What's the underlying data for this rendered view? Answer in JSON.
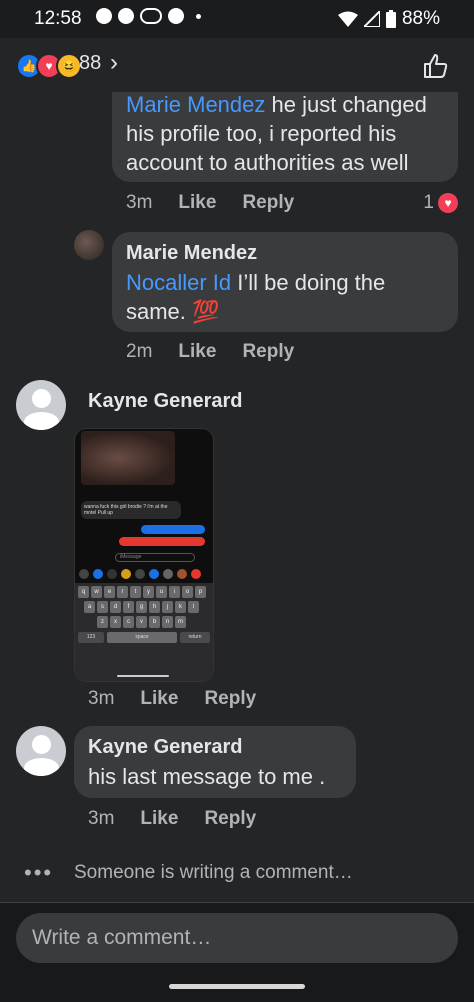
{
  "status": {
    "time": "12:58",
    "battery": "88%"
  },
  "reactions": {
    "count": "88",
    "chevron": "›"
  },
  "comments": [
    {
      "mention": "Marie Mendez",
      "text_after_mention": " he just changed his profile too, i reported his account to authorities as well",
      "time": "3m",
      "like": "Like",
      "reply": "Reply",
      "reaction_count": "1"
    },
    {
      "author": "Marie Mendez",
      "mention": "Nocaller Id",
      "text_after_mention": " I’ll be doing the same. 💯",
      "time": "2m",
      "like": "Like",
      "reply": "Reply"
    },
    {
      "author": "Kayne Generard",
      "time": "3m",
      "like": "Like",
      "reply": "Reply"
    },
    {
      "author": "Kayne Generard",
      "text": "his last message to me .",
      "time": "3m",
      "like": "Like",
      "reply": "Reply"
    }
  ],
  "attachment": {
    "message": "wanna fuck this girl brodie ? i'm at the motel Pull up",
    "input_placeholder": "iMessage",
    "keyboard_rows": [
      [
        "q",
        "w",
        "e",
        "r",
        "t",
        "y",
        "u",
        "i",
        "o",
        "p"
      ],
      [
        "a",
        "s",
        "d",
        "f",
        "g",
        "h",
        "j",
        "k",
        "l"
      ],
      [
        "z",
        "x",
        "c",
        "v",
        "b",
        "n",
        "m"
      ]
    ],
    "key_123": "123",
    "key_space": "space",
    "key_return": "return"
  },
  "writing_indicator": "Someone is writing a comment…",
  "composer": {
    "placeholder": "Write a comment…"
  },
  "colors": {
    "background": "#242526",
    "bubble": "#3a3b3c",
    "mention": "#4599ff",
    "love": "#f33e58"
  }
}
